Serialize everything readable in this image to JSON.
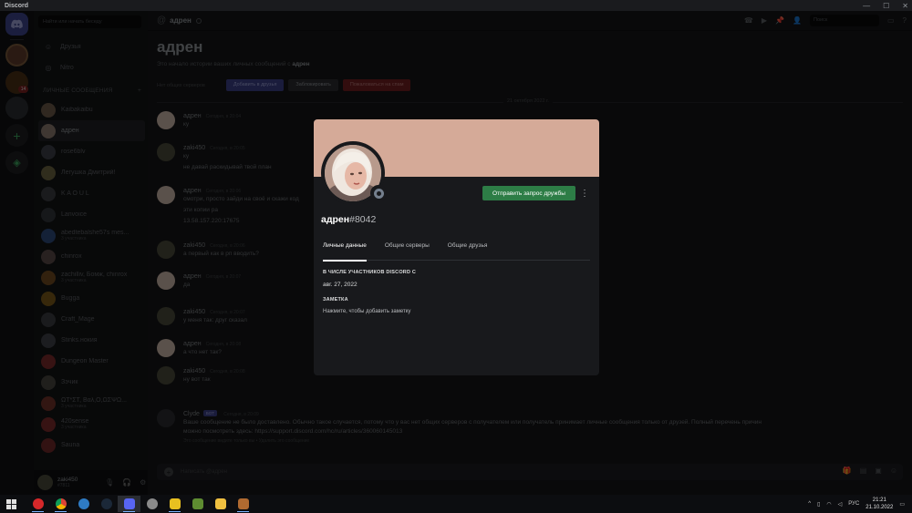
{
  "titlebar": {
    "title": "Discord"
  },
  "servers": {
    "badge": "14"
  },
  "sidebar": {
    "search_placeholder": "Найти или начать беседу",
    "nav": [
      {
        "label": "Друзья",
        "icon": "friends-icon"
      },
      {
        "label": "Nitro",
        "icon": "nitro-icon"
      }
    ],
    "dm_header": "ЛИЧНЫЕ СООБЩЕНИЯ",
    "dms": [
      {
        "name": "Kaibakaibu",
        "sub": "",
        "color": "#6b5a48"
      },
      {
        "name": "адрен",
        "sub": "",
        "color": "#8b7a70",
        "active": true
      },
      {
        "name": "rose6blv",
        "sub": "",
        "color": "#3b3f46"
      },
      {
        "name": "Легушка Дмитрий!",
        "sub": "",
        "color": "#6a6440"
      },
      {
        "name": "K A O U L",
        "sub": "",
        "color": "#3a3c40"
      },
      {
        "name": "Lanvoice",
        "sub": "",
        "color": "#30353a"
      },
      {
        "name": "abedtebalshe57s mes...",
        "sub": "3 участника",
        "color": "#2c4a7a"
      },
      {
        "name": "chinrox",
        "sub": "",
        "color": "#5a4a48"
      },
      {
        "name": "zachilliv, Бомж, chinrox",
        "sub": "3 участника",
        "color": "#6e4a20"
      },
      {
        "name": "Bugga",
        "sub": "",
        "color": "#7a5a18"
      },
      {
        "name": "Craft_Mage",
        "sub": "",
        "color": "#3a3c40"
      },
      {
        "name": "Stinks.нокия",
        "sub": "",
        "color": "#3e4046"
      },
      {
        "name": "Dungeon Master",
        "sub": "",
        "color": "#7a2a2a"
      },
      {
        "name": "Зэчик",
        "sub": "",
        "color": "#48443e"
      },
      {
        "name": "ΩΤ*ΣΤ, Βαλ,Ο,ΩΣΨΩ...",
        "sub": "3 участника",
        "color": "#6e3028"
      },
      {
        "name": "420sense",
        "sub": "3 участника",
        "color": "#7a2a2a"
      },
      {
        "name": "Sauna",
        "sub": "",
        "color": "#6e2828"
      }
    ]
  },
  "user": {
    "name": "zaki450",
    "tag": "#7811"
  },
  "chat": {
    "header_name": "адрен",
    "search_placeholder": "Поиск",
    "intro_title": "адрен",
    "intro_text": "Это начало истории ваших личных сообщений с",
    "intro_name": "адрен",
    "intro_no_servers": "Нет общих серверов",
    "btn_add": "Добавить в друзья",
    "btn_block": "Заблокировать",
    "btn_report": "Пожаловаться на спам",
    "date_divider": "21 октября 2022 г.",
    "composer_placeholder": "Написать @адрен",
    "messages": [
      {
        "author": "адрен",
        "time": "Сегодня, в 20:04",
        "lines": [
          "ку"
        ],
        "color": "#c9b3a6"
      },
      {
        "author": "zaki450",
        "time": "Сегодня, в 20:05",
        "lines": [
          "ку",
          "не давай раскидывай твой план"
        ],
        "color": "#4a4a3a"
      },
      {
        "author": "адрен",
        "time": "Сегодня, в 20:06",
        "lines": [
          "смотри, просто зайди на своё и скажи код",
          "эти копии ра",
          "13.58.157.220:17675"
        ],
        "color": "#c9b3a6"
      },
      {
        "author": "zaki450",
        "time": "Сегодня, в 20:06",
        "lines": [
          "а первый как в рп вводить?"
        ],
        "color": "#4a4a3a"
      },
      {
        "author": "адрен",
        "time": "Сегодня, в 20:07",
        "lines": [
          "да"
        ],
        "color": "#c9b3a6"
      },
      {
        "author": "zaki450",
        "time": "Сегодня, в 20:07",
        "lines": [
          "у меня так: друг сказал"
        ],
        "color": "#4a4a3a"
      },
      {
        "author": "адрен",
        "time": "Сегодня, в 20:08",
        "lines": [
          "а что нет так?"
        ],
        "color": "#c9b3a6"
      },
      {
        "author": "zaki450",
        "time": "Сегодня, в 20:08",
        "lines": [
          "ну вот так"
        ],
        "color": "#4a4a3a"
      }
    ],
    "clyde": {
      "author": "Clyde",
      "bot": "БОТ",
      "time": "Сегодня, в 20:09",
      "line1": "Ваше сообщение не было доставлено. Обычно такое случается, потому что у вас нет общих серверов с получателем или получатель принимает личные сообщения только от друзей. Полный перечень причин",
      "line2": "можно посмотреть здесь: https://support.discord.com/hc/ru/articles/360060145013",
      "note": "Это сообщение видите только вы • Удалить это сообщение"
    }
  },
  "profile": {
    "username": "адрен",
    "discriminator": "#8042",
    "banner_color": "#d5aa98",
    "friend_button": "Отправить запрос дружбы",
    "tabs": [
      "Личные данные",
      "Общие серверы",
      "Общие друзья"
    ],
    "member_since_header": "В ЧИСЛЕ УЧАСТНИКОВ DISCORD С",
    "member_since": "авг. 27, 2022",
    "note_header": "ЗАМЕТКА",
    "note_placeholder": "Нажмите, чтобы добавить заметку"
  },
  "taskbar": {
    "lang": "РУС",
    "time": "21:21",
    "date": "21.10.2022"
  }
}
